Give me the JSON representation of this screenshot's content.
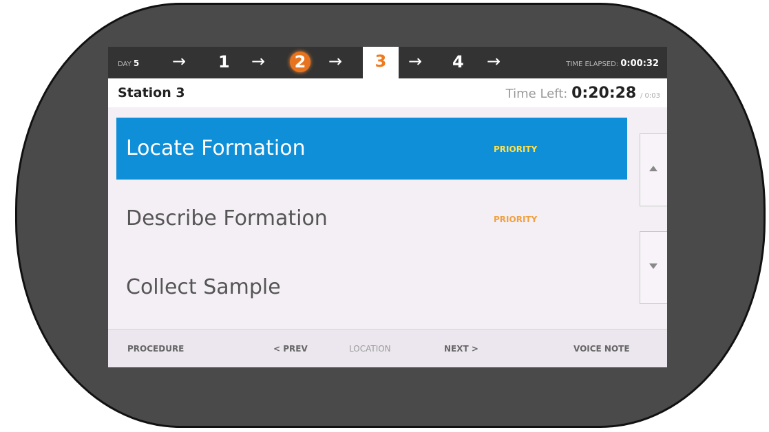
{
  "topbar": {
    "day_label": "DAY",
    "day_value": "5",
    "arrow": "→",
    "steps": [
      "1",
      "2",
      "3",
      "4"
    ],
    "current_step": "3",
    "completed_step": "2",
    "elapsed_label": "TIME ELAPSED:",
    "elapsed_value": "0:00:32"
  },
  "header": {
    "station": "Station 3",
    "time_left_label": "Time Left:",
    "time_left_value": "0:20:28",
    "time_left_total": "/ 0:03"
  },
  "tasks": [
    {
      "name": "Locate Formation",
      "badge": "PRIORITY",
      "selected": true
    },
    {
      "name": "Describe Formation",
      "badge": "PRIORITY",
      "selected": false
    },
    {
      "name": "Collect Sample",
      "badge": "",
      "selected": false
    }
  ],
  "scroll": {
    "up_icon": "triangle-up-icon",
    "down_icon": "triangle-down-icon"
  },
  "footer": {
    "procedure": "PROCEDURE",
    "prev": "< PREV",
    "location": "LOCATION",
    "next": "NEXT >",
    "voice_note": "VOICE NOTE"
  },
  "colors": {
    "selected_row": "#0f8fd8",
    "priority_on_selected": "#ffe14d",
    "priority": "#f0a040",
    "current_step": "#f07a1e",
    "completed_step": "#e8731e",
    "topbar": "#333333"
  }
}
